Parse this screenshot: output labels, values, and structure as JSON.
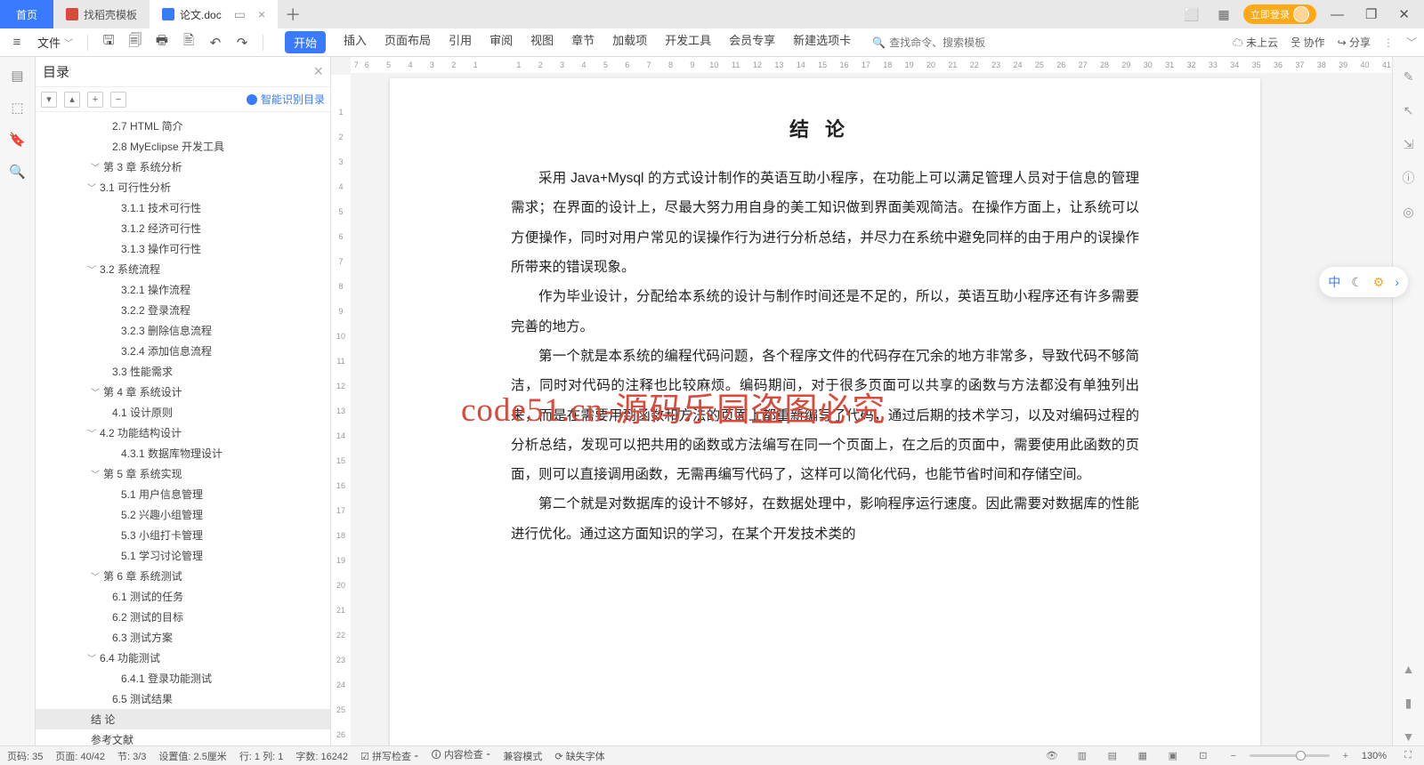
{
  "titlebar": {
    "home": "首页",
    "template": "找稻壳模板",
    "doc": "论文.doc",
    "login": "立即登录"
  },
  "toolbar": {
    "file": "文件",
    "menus": [
      "开始",
      "插入",
      "页面布局",
      "引用",
      "审阅",
      "视图",
      "章节",
      "加载项",
      "开发工具",
      "会员专享",
      "新建选项卡"
    ],
    "search_ph": "查找命令、搜索模板",
    "cloud": "未上云",
    "collab": "协作",
    "share": "分享"
  },
  "outline": {
    "title": "目录",
    "smart": "智能识别目录",
    "items": [
      {
        "t": "2.7 HTML 简介",
        "lv": "p1"
      },
      {
        "t": "2.8 MyEclipse 开发工具",
        "lv": "p1"
      },
      {
        "t": "第 3 章  系统分析",
        "lv": "lv0",
        "c": 1
      },
      {
        "t": "3.1  可行性分析",
        "lv": "lv1",
        "c": 1
      },
      {
        "t": "3.1.1  技术可行性",
        "lv": "lv3"
      },
      {
        "t": "3.1.2  经济可行性",
        "lv": "lv3"
      },
      {
        "t": "3.1.3  操作可行性",
        "lv": "lv3"
      },
      {
        "t": "3.2  系统流程",
        "lv": "lv1",
        "c": 1
      },
      {
        "t": "3.2.1  操作流程",
        "lv": "lv3"
      },
      {
        "t": "3.2.2  登录流程",
        "lv": "lv3"
      },
      {
        "t": "3.2.3  删除信息流程",
        "lv": "lv3"
      },
      {
        "t": "3.2.4  添加信息流程",
        "lv": "lv3"
      },
      {
        "t": "3.3  性能需求",
        "lv": "p1"
      },
      {
        "t": "第 4 章  系统设计",
        "lv": "lv0",
        "c": 1
      },
      {
        "t": "4.1  设计原则",
        "lv": "p1"
      },
      {
        "t": "4.2  功能结构设计",
        "lv": "lv1",
        "c": 1
      },
      {
        "t": "4.3.1  数据库物理设计",
        "lv": "lv3"
      },
      {
        "t": "第 5 章  系统实现",
        "lv": "lv0",
        "c": 1
      },
      {
        "t": "5.1  用户信息管理",
        "lv": "lv3"
      },
      {
        "t": "5.2  兴趣小组管理",
        "lv": "lv3"
      },
      {
        "t": "5.3  小组打卡管理",
        "lv": "lv3"
      },
      {
        "t": "5.1  学习讨论管理",
        "lv": "lv3"
      },
      {
        "t": "第 6 章  系统测试",
        "lv": "lv0",
        "c": 1
      },
      {
        "t": "6.1  测试的任务",
        "lv": "p1"
      },
      {
        "t": "6.2  测试的目标",
        "lv": "p1"
      },
      {
        "t": "6.3  测试方案",
        "lv": "p1"
      },
      {
        "t": "6.4  功能测试",
        "lv": "lv1",
        "c": 1
      },
      {
        "t": "6.4.1  登录功能测试",
        "lv": "lv3"
      },
      {
        "t": "6.5  测试结果",
        "lv": "p1"
      },
      {
        "t": "结    论",
        "lv": "lv0",
        "sel": 1
      },
      {
        "t": "参考文献",
        "lv": "lv0"
      }
    ]
  },
  "doc": {
    "heading": "结论",
    "p1": "采用 Java+Mysql 的方式设计制作的英语互助小程序，在功能上可以满足管理人员对于信息的管理需求；在界面的设计上，尽最大努力用自身的美工知识做到界面美观简洁。在操作方面上，让系统可以方便操作，同时对用户常见的误操作行为进行分析总结，并尽力在系统中避免同样的由于用户的误操作所带来的错误现象。",
    "p2": "作为毕业设计，分配给本系统的设计与制作时间还是不足的，所以，英语互助小程序还有许多需要完善的地方。",
    "p3": "第一个就是本系统的编程代码问题，各个程序文件的代码存在冗余的地方非常多，导致代码不够简洁，同时对代码的注释也比较麻烦。编码期间，对于很多页面可以共享的函数与方法都没有单独列出来，而是在需要用到函数和方法的页面上都重新编写了代码，通过后期的技术学习，以及对编码过程的分析总结，发现可以把共用的函数或方法编写在同一个页面上，在之后的页面中，需要使用此函数的页面，则可以直接调用函数，无需再编写代码了，这样可以简化代码，也能节省时间和存储空间。",
    "p4": "第二个就是对数据库的设计不够好，在数据处理中，影响程序运行速度。因此需要对数据库的性能进行优化。通过这方面知识的学习，在某个开发技术类的",
    "watermark": "code51.cn-源码乐园盗图必究"
  },
  "ruler_h": [
    "7",
    "6",
    "",
    "5",
    "",
    "4",
    "",
    "3",
    "",
    "2",
    "",
    "1",
    "",
    "",
    "",
    "1",
    "",
    "2",
    "",
    "3",
    "",
    "4",
    "",
    "5",
    "",
    "6",
    "",
    "7",
    "",
    "8",
    "",
    "9",
    "",
    "10",
    "",
    "11",
    "",
    "12",
    "",
    "13",
    "",
    "14",
    "",
    "15",
    "",
    "16",
    "",
    "17",
    "",
    "18",
    "",
    "19",
    "",
    "20",
    "",
    "21",
    "",
    "22",
    "",
    "23",
    "",
    "24",
    "",
    "25",
    "",
    "26",
    "",
    "27",
    "",
    "28",
    "",
    "29",
    "",
    "30",
    "",
    "31",
    "",
    "32",
    "",
    "33",
    "",
    "34",
    "",
    "35",
    "",
    "36",
    "",
    "37",
    "",
    "38",
    "",
    "39",
    "",
    "40",
    "",
    "41"
  ],
  "ruler_v": [
    "",
    "1",
    "2",
    "3",
    "4",
    "5",
    "6",
    "7",
    "8",
    "9",
    "10",
    "11",
    "12",
    "13",
    "14",
    "15",
    "16",
    "17",
    "18",
    "19",
    "20",
    "21",
    "22",
    "23",
    "24",
    "25",
    "26"
  ],
  "status": {
    "page_no": "页码: 35",
    "page": "页面: 40/42",
    "sec": "节: 3/3",
    "setval": "设置值: 2.5厘米",
    "line": "行: 1  列: 1",
    "words": "字数: 16242",
    "spell": "拼写检查 ",
    "content": "内容检查 ",
    "compat": "兼容模式",
    "missing": "缺失字体",
    "zoom": "130%"
  }
}
